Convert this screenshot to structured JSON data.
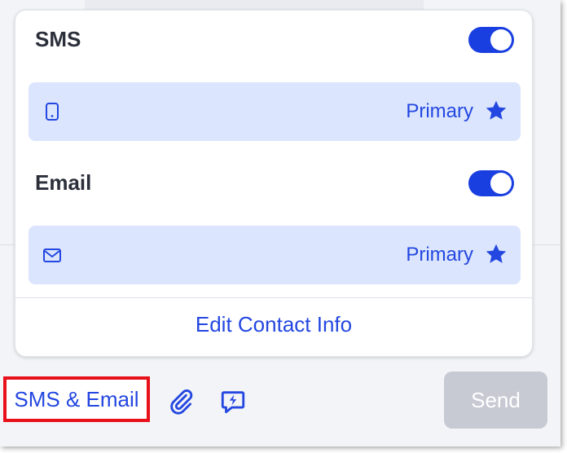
{
  "popover": {
    "sms": {
      "title": "SMS",
      "toggle_on": true,
      "primary_label": "Primary",
      "icon": "phone-icon"
    },
    "email": {
      "title": "Email",
      "toggle_on": true,
      "primary_label": "Primary",
      "icon": "envelope-icon"
    },
    "edit_link": "Edit Contact Info"
  },
  "bottom_bar": {
    "channel_label": "SMS & Email",
    "attach_icon": "paperclip-icon",
    "quick_reply_icon": "lightning-chat-icon",
    "send_label": "Send"
  },
  "colors": {
    "accent": "#2347e0",
    "toggle": "#1a3fe0",
    "row_bg": "#dbe5fd",
    "send_disabled": "#c7cad3",
    "highlight": "#e8101a"
  }
}
